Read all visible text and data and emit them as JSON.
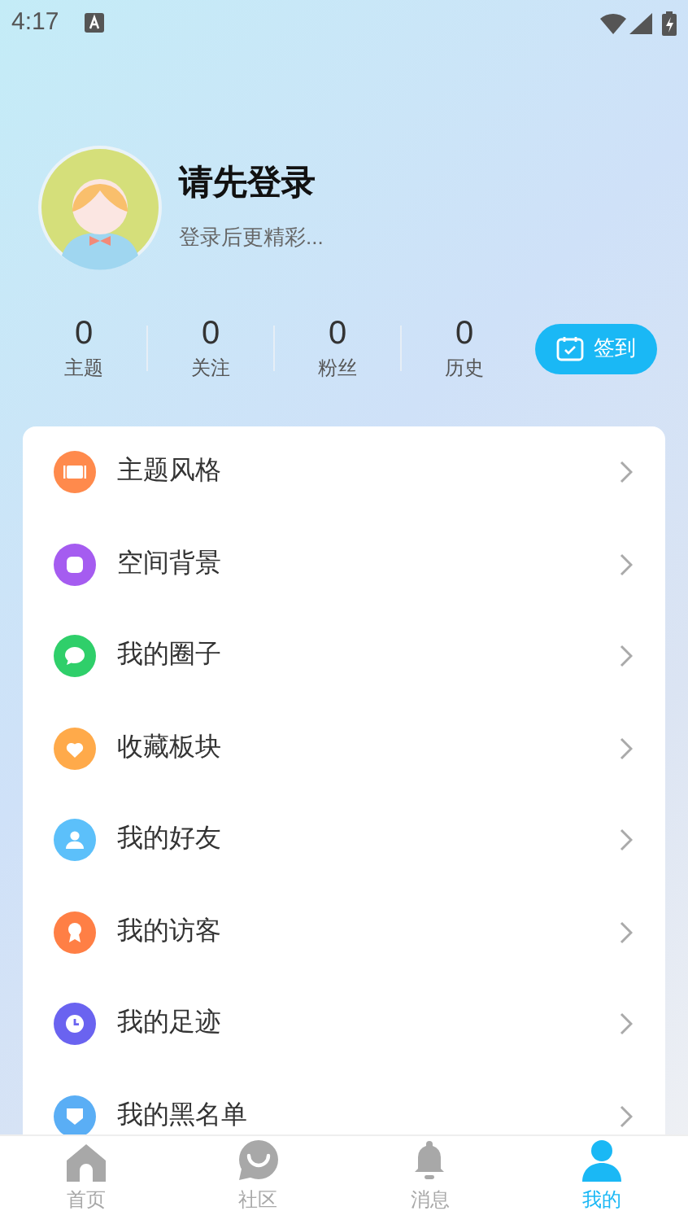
{
  "status_bar": {
    "time": "4:17"
  },
  "profile": {
    "name": "请先登录",
    "subtitle": "登录后更精彩..."
  },
  "stats": [
    {
      "value": "0",
      "label": "主题"
    },
    {
      "value": "0",
      "label": "关注"
    },
    {
      "value": "0",
      "label": "粉丝"
    },
    {
      "value": "0",
      "label": "历史"
    }
  ],
  "checkin_button": {
    "label": "签到"
  },
  "menu": [
    {
      "label": "主题风格",
      "kind": "theme",
      "color": "#ff8a4c"
    },
    {
      "label": "空间背景",
      "kind": "background",
      "color": "#a55cf0"
    },
    {
      "label": "我的圈子",
      "kind": "circle",
      "color": "#2fcf6a"
    },
    {
      "label": "收藏板块",
      "kind": "favorite",
      "color": "#ffaa4a"
    },
    {
      "label": "我的好友",
      "kind": "friends",
      "color": "#5cc0fa"
    },
    {
      "label": "我的访客",
      "kind": "visitors",
      "color": "#ff7f45"
    },
    {
      "label": "我的足迹",
      "kind": "footprint",
      "color": "#6a63f0"
    },
    {
      "label": "我的黑名单",
      "kind": "blacklist",
      "color": "#5aaef5"
    }
  ],
  "bottom_nav": [
    {
      "label": "首页",
      "kind": "home",
      "selected": false
    },
    {
      "label": "社区",
      "kind": "community",
      "selected": false
    },
    {
      "label": "消息",
      "kind": "messages",
      "selected": false
    },
    {
      "label": "我的",
      "kind": "me",
      "selected": true
    }
  ]
}
